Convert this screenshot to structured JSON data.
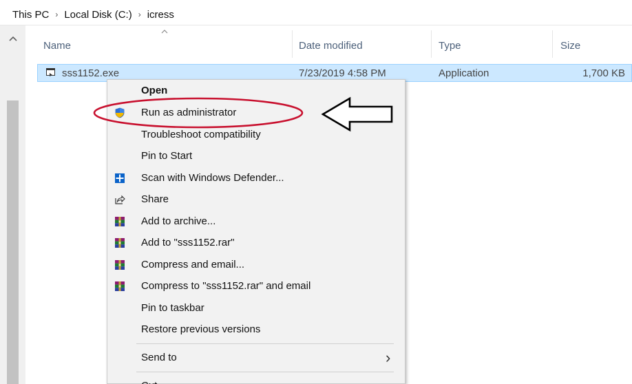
{
  "breadcrumb": {
    "items": [
      "This PC",
      "Local Disk (C:)",
      "icress"
    ],
    "separator": "›"
  },
  "columns": {
    "name": "Name",
    "date_modified": "Date modified",
    "type": "Type",
    "size": "Size"
  },
  "file": {
    "name": "sss1152.exe",
    "date_modified": "7/23/2019 4:58 PM",
    "type": "Application",
    "size": "1,700 KB"
  },
  "context_menu": {
    "items": [
      {
        "label": "Open",
        "bold": true,
        "icon": ""
      },
      {
        "label": "Run as administrator",
        "icon": "shield-icon"
      },
      {
        "label": "Troubleshoot compatibility",
        "icon": ""
      },
      {
        "label": "Pin to Start",
        "icon": ""
      },
      {
        "label": "Scan with Windows Defender...",
        "icon": "defender-icon"
      },
      {
        "label": "Share",
        "icon": "share-icon"
      },
      {
        "label": "Add to archive...",
        "icon": "winrar-icon"
      },
      {
        "label": "Add to \"sss1152.rar\"",
        "icon": "winrar-icon"
      },
      {
        "label": "Compress and email...",
        "icon": "winrar-icon"
      },
      {
        "label": "Compress to \"sss1152.rar\" and email",
        "icon": "winrar-icon"
      },
      {
        "label": "Pin to taskbar",
        "icon": ""
      },
      {
        "label": "Restore previous versions",
        "icon": ""
      },
      {
        "label": "Send to",
        "icon": "",
        "submenu_arrow": "›"
      },
      {
        "label": "Cut",
        "icon": ""
      }
    ]
  },
  "annotations": {
    "highlight": "Run as administrator",
    "ellipse_color": "#c8102e",
    "arrow_color": "#000000"
  },
  "colors": {
    "selection_bg": "#cce8ff",
    "selection_border": "#99d1ff",
    "menu_bg": "#f2f2f2",
    "header_text": "#4c607a"
  }
}
